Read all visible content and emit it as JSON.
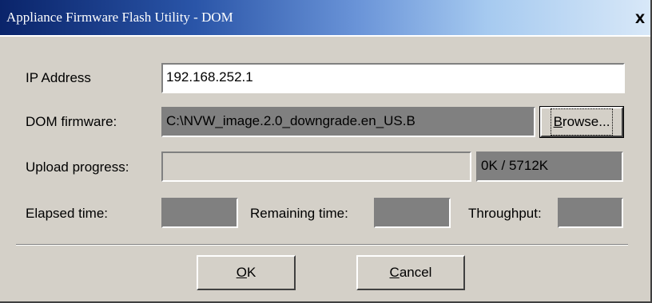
{
  "window": {
    "title": "Appliance Firmware Flash Utility - DOM",
    "close_label": "X"
  },
  "ip": {
    "label": "IP Address",
    "value": "192.168.252.1"
  },
  "firmware": {
    "label": "DOM firmware:",
    "value": "C:\\NVW_image.2.0_downgrade.en_US.B",
    "browse_label": "Browse..."
  },
  "upload": {
    "label": "Upload progress:",
    "progress_fraction": 0,
    "size_text": "0K / 5712K"
  },
  "elapsed": {
    "label": "Elapsed time:",
    "value": ""
  },
  "remaining": {
    "label": "Remaining time:",
    "value": ""
  },
  "throughput": {
    "label": "Throughput:",
    "value": ""
  },
  "buttons": {
    "ok_label": "OK",
    "cancel_label": "Cancel"
  },
  "colors": {
    "titlebar_start": "#0a246a",
    "titlebar_end": "#d8e8f8",
    "face": "#d4d0c8",
    "readonly_fill": "#808080"
  }
}
